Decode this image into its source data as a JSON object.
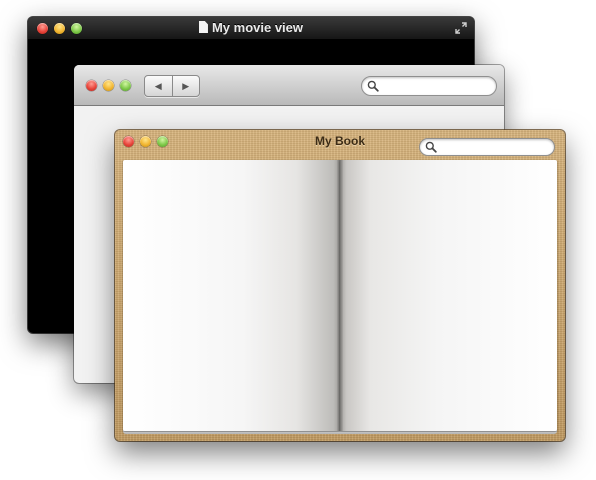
{
  "movie_window": {
    "title": "My movie view",
    "icons": [
      "document-icon",
      "fullscreen-icon"
    ],
    "background": "#000000"
  },
  "browser_window": {
    "nav": {
      "back_glyph": "◀",
      "forward_glyph": "▶"
    },
    "search": {
      "value": "",
      "placeholder": ""
    }
  },
  "book_window": {
    "title": "My Book",
    "search": {
      "value": "",
      "placeholder": ""
    },
    "leather_color": "#c9a36a"
  },
  "traffic_lights": {
    "close": "#e8453b",
    "minimize": "#f2b632",
    "zoom": "#7fc94a"
  }
}
